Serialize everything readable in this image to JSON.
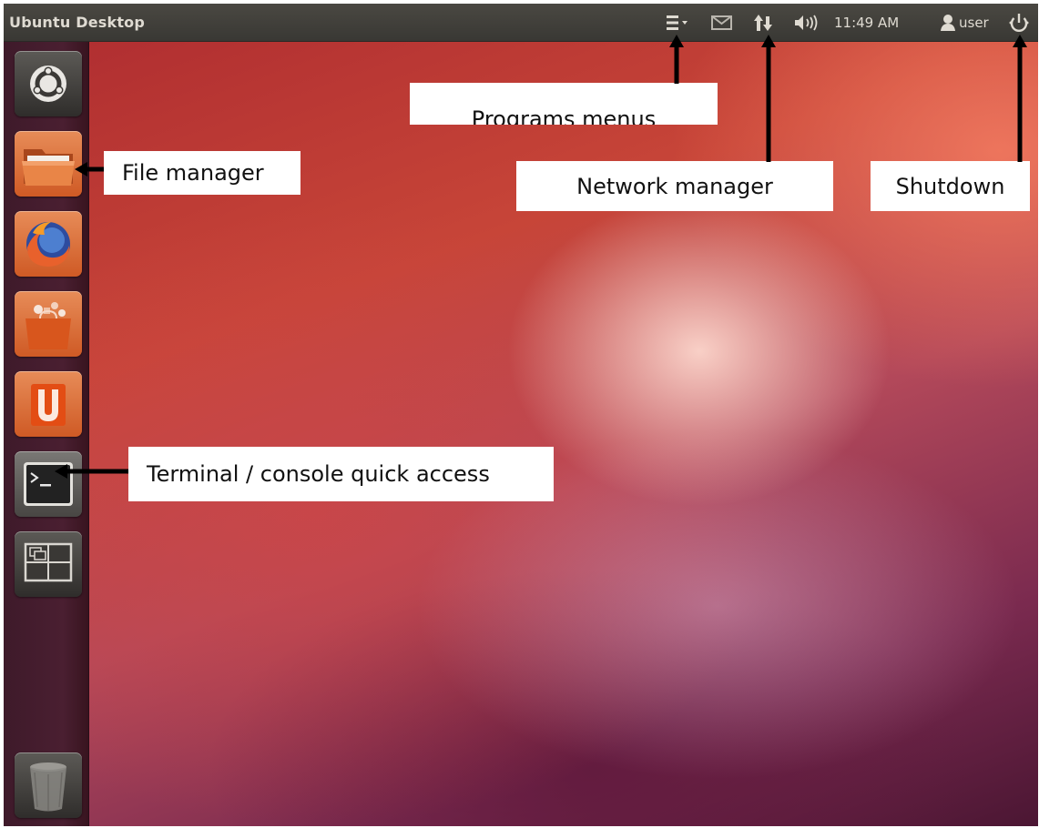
{
  "panel": {
    "title": "Ubuntu Desktop",
    "clock": "11:49 AM",
    "user": "user",
    "icons": [
      "menu-icon",
      "mail-icon",
      "network-icon",
      "volume-icon",
      "user-icon",
      "power-icon"
    ]
  },
  "launcher": {
    "items": [
      {
        "name": "dash-home",
        "icon": "ubuntu-logo-icon"
      },
      {
        "name": "file-manager",
        "icon": "folder-icon"
      },
      {
        "name": "firefox",
        "icon": "firefox-icon"
      },
      {
        "name": "software-center",
        "icon": "shopping-bag-icon"
      },
      {
        "name": "ubuntu-one",
        "icon": "ubuntu-one-icon"
      },
      {
        "name": "terminal",
        "icon": "terminal-icon"
      },
      {
        "name": "workspace-switcher",
        "icon": "workspaces-icon"
      },
      {
        "name": "trash",
        "icon": "trash-icon"
      }
    ]
  },
  "callouts": {
    "programs_menus": "Programs menus",
    "file_manager": "File manager",
    "network_manager": "Network manager",
    "shutdown": "Shutdown",
    "terminal": "Terminal / console quick access"
  },
  "colors": {
    "panel": "#3c3b37",
    "panel_text": "#dfdbd2",
    "accent_orange": "#dd4814",
    "launcher_bg": "#451c2e"
  }
}
